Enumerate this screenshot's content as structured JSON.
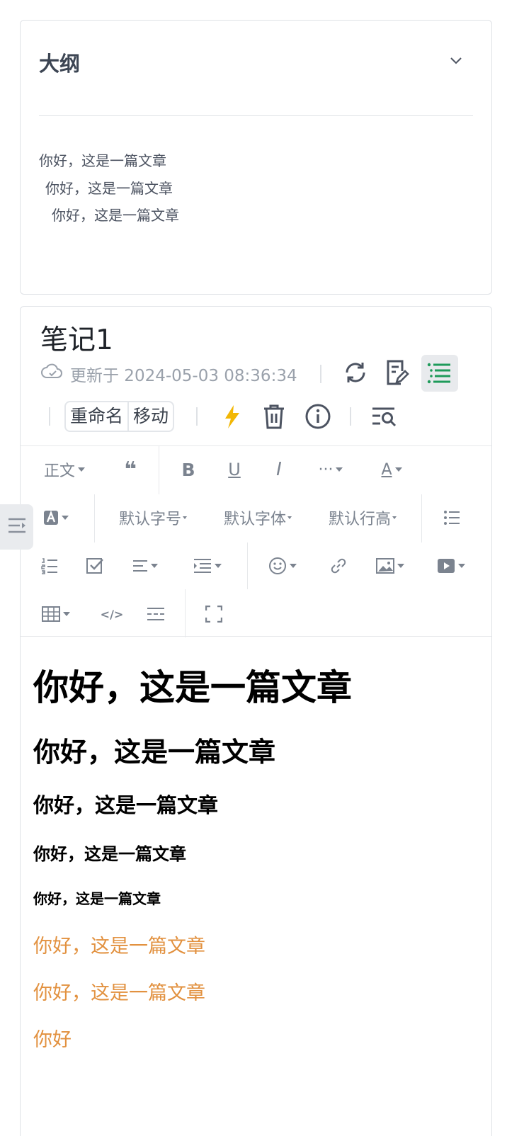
{
  "outline": {
    "title": "大纲",
    "items": [
      "你好，这是一篇文章",
      "你好，这是一篇文章",
      "你好，这是一篇文章"
    ]
  },
  "note": {
    "title": "笔记1",
    "updated": "更新于 2024-05-03 08:36:34",
    "buttons": {
      "rename": "重命名",
      "move": "移动"
    }
  },
  "toolbar": {
    "paragraph": "正文",
    "font_size": "默认字号",
    "font_family": "默认字体",
    "line_height": "默认行高",
    "more": "···"
  },
  "content": {
    "h1": "你好，这是一篇文章",
    "h2": "你好，这是一篇文章",
    "h3": "你好，这是一篇文章",
    "h4": "你好，这是一篇文章",
    "h5": "你好，这是一篇文章",
    "p1": "你好，这是一篇文章",
    "p2": "你好，这是一篇文章",
    "p3": "你好"
  },
  "colors": {
    "accent_green": "#1e9b5a",
    "text_orange": "#e2913f",
    "star_yellow": "#f2b705"
  }
}
